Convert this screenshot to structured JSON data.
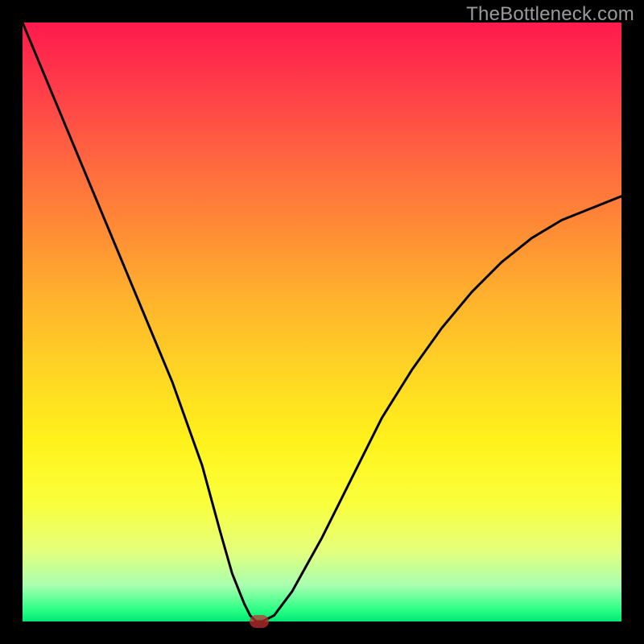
{
  "watermark": "TheBottleneck.com",
  "chart_data": {
    "type": "line",
    "title": "",
    "xlabel": "",
    "ylabel": "",
    "xlim": [
      0,
      100
    ],
    "ylim": [
      0,
      100
    ],
    "grid": false,
    "legend": false,
    "series": [
      {
        "name": "bottleneck-curve",
        "x": [
          0,
          5,
          10,
          15,
          20,
          25,
          30,
          33,
          35,
          37,
          38,
          39,
          40,
          42,
          45,
          50,
          55,
          60,
          65,
          70,
          75,
          80,
          85,
          90,
          95,
          100
        ],
        "y": [
          100,
          88,
          76,
          64,
          52,
          40,
          26,
          15,
          8,
          3,
          1,
          0,
          0,
          1,
          5,
          14,
          24,
          34,
          42,
          49,
          55,
          60,
          64,
          67,
          69,
          71
        ]
      }
    ],
    "marker": {
      "x": 39.5,
      "y": 0
    },
    "background_gradient": {
      "orientation": "vertical",
      "stops": [
        {
          "pos": 0.0,
          "color": "#ff1a4d"
        },
        {
          "pos": 0.5,
          "color": "#ffd424"
        },
        {
          "pos": 0.9,
          "color": "#e6ff7a"
        },
        {
          "pos": 1.0,
          "color": "#00e874"
        }
      ]
    }
  },
  "colors": {
    "curve": "#000000",
    "marker": "#c42f2f",
    "frame": "#000000",
    "watermark": "#9a9a9a"
  }
}
